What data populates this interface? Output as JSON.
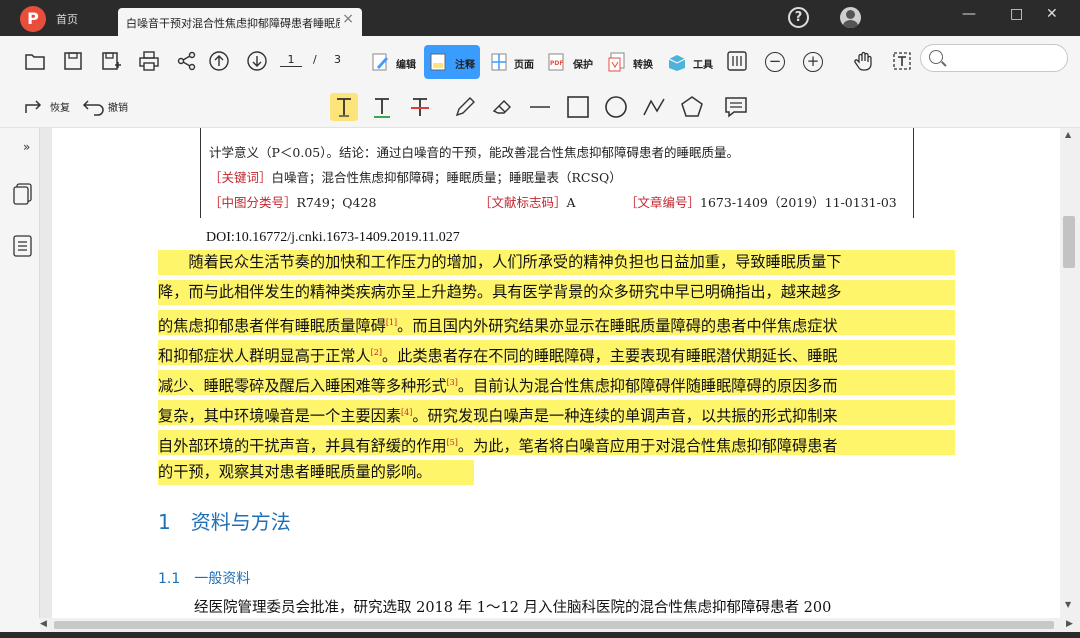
{
  "titlebar": {
    "home_tab": "首页",
    "doc_tab": "白噪音干预对混合性焦虑抑郁障碍患者睡眠质...",
    "help_icon": "?",
    "close_glyph": "×",
    "min_glyph": "—",
    "max_glyph": "□",
    "winclose_glyph": "✕"
  },
  "toolbar": {
    "page_current": "1",
    "page_sep": "/",
    "page_total": "3",
    "modes": [
      {
        "label": "编辑",
        "icon": "edit-icon"
      },
      {
        "label": "注释",
        "icon": "annotate-icon",
        "active": true
      },
      {
        "label": "页面",
        "icon": "page-icon"
      },
      {
        "label": "保护",
        "icon": "protect-icon"
      },
      {
        "label": "转换",
        "icon": "convert-icon"
      },
      {
        "label": "工具",
        "icon": "tools-icon"
      }
    ],
    "zoom_out": "−",
    "zoom_in": "+"
  },
  "toolbar2": {
    "redo_label": "恢复",
    "undo_label": "撤销"
  },
  "document": {
    "abstract_line1": "计学意义（P＜0.05）。结论：通过白噪音的干预，能改善混合性焦虑抑郁障碍患者的睡眠质量。",
    "keywords_tag": "［关键词］",
    "keywords": "白噪音；混合性焦虑抑郁障碍；睡眠质量；睡眠量表（RCSQ）",
    "clc_tag": "［中图分类号］",
    "clc": "R749；Q428",
    "doccode_tag": "［文献标志码］",
    "doccode": "A",
    "articleno_tag": "［文章编号］",
    "articleno": "1673-1409（2019）11-0131-03",
    "doi": "DOI:10.16772/j.cnki.1673-1409.2019.11.027",
    "body_lines": [
      "　　随着民众生活节奏的加快和工作压力的增加，人们所承受的精神负担也日益加重，导致睡眠质量下",
      "降，而与此相伴发生的精神类疾病亦呈上升趋势。具有医学背景的众多研究中早已明确指出，越来越多",
      "的焦虑抑郁患者伴有睡眠质量障碍",
      "。而且国内外研究结果亦显示在睡眠质量障碍的患者中伴焦虑症状",
      "和抑郁症状人群明显高于正常人",
      "。此类患者存在不同的睡眠障碍，主要表现有睡眠潜伏期延长、睡眠",
      "减少、睡眠零碎及醒后入睡困难等多种形式",
      "。目前认为混合性焦虑抑郁障碍伴随睡眠障碍的原因多而",
      "复杂，其中环境噪音是一个主要因素",
      "。研究发现白噪声是一种连续的单调声音，以共振的形式抑制来",
      "自外部环境的干扰声音，并具有舒缓的作用",
      "。为此，笔者将白噪音应用于对混合性焦虑抑郁障碍患者",
      "的干预，观察其对患者睡眠质量的影响。"
    ],
    "refs": [
      "[1]",
      "[2]",
      "[3]",
      "[4]",
      "[5]"
    ],
    "section1": "1　资料与方法",
    "section11": "1.1　一般资料",
    "para2": "经医院管理委员会批准，研究选取 2018 年 1～12 月入住脑科医院的混合性焦虑抑郁障碍患者 200"
  },
  "colors": {
    "highlight": "#fff56a",
    "accent": "#3b9cff",
    "heading_blue": "#1f6fb7",
    "tag_red": "#c3262e"
  }
}
